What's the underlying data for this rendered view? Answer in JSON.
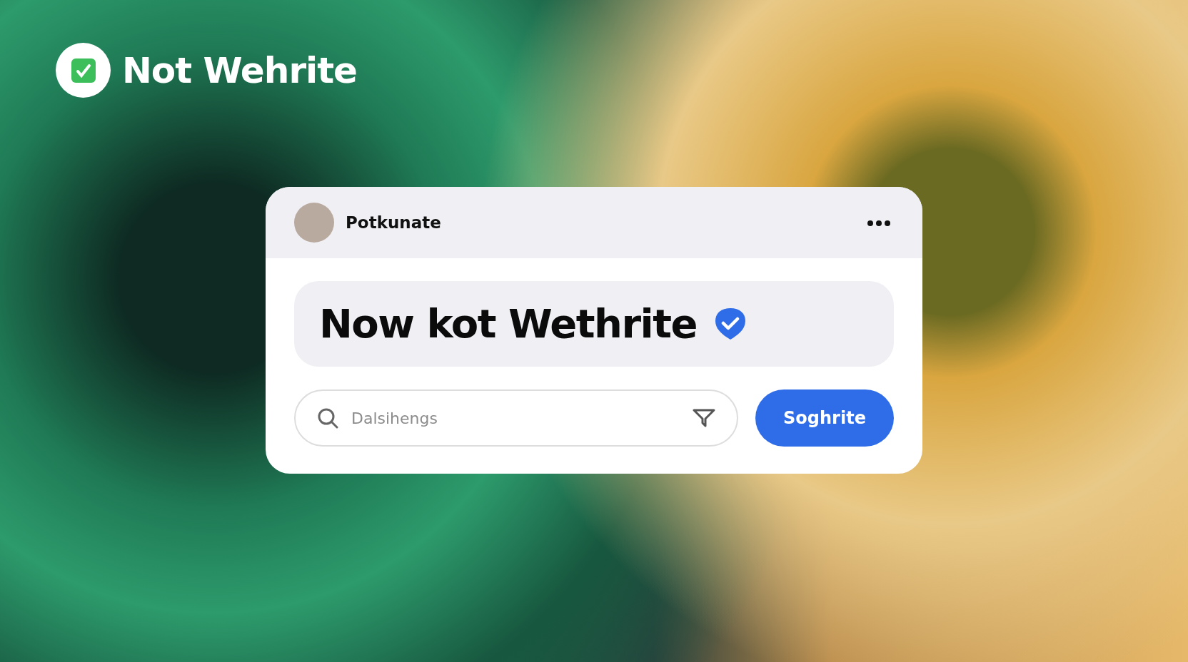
{
  "brand": {
    "title": "Not Wehrite"
  },
  "card": {
    "user": {
      "name": "Potkunate"
    },
    "headline": {
      "text": "Now kot Wethrite",
      "verified": true
    },
    "search": {
      "placeholder": "Dalsihengs"
    },
    "button": {
      "label": "Soghrite"
    }
  }
}
